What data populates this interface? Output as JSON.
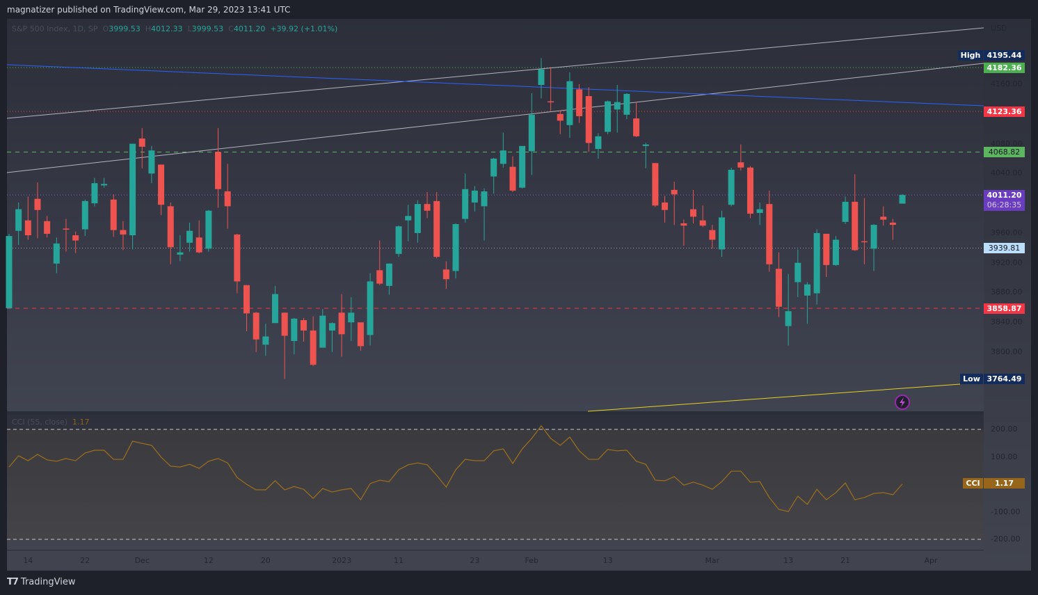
{
  "header": {
    "publisher": "magnatizer published on TradingView.com, Mar 29, 2023 13:41 UTC"
  },
  "legend": {
    "symbol": "S&P 500 Index, 1D, SP",
    "o_label": "O",
    "open": "3999.53",
    "h_label": "H",
    "high": "4012.33",
    "l_label": "L",
    "low": "3999.53",
    "c_label": "C",
    "close": "4011.20",
    "change": "+39.92 (+1.01%)"
  },
  "footer": {
    "brand": "TradingView"
  },
  "colors": {
    "up": "#26a69a",
    "down": "#ef5350",
    "cci": "#a0701a",
    "trend_blue": "#2962ff",
    "trend_white": "#b2b5be",
    "trend_yellow": "#e6d21f"
  },
  "badges": {
    "high_label": "High",
    "high_value": "4195.44",
    "level1": "4182.36",
    "level2": "4123.36",
    "level3": "4068.82",
    "last_price": "4011.20",
    "countdown": "06:28:35",
    "level4": "3939.81",
    "level5": "3858.87",
    "low_label": "Low",
    "low_value": "3764.49",
    "cci_label": "CCI",
    "cci_value": "1.17"
  },
  "chart_data": {
    "type": "candlestick",
    "currency": "USD",
    "price_ticks": [
      "4160.00",
      "4080.00",
      "4040.00",
      "3960.00",
      "3920.00",
      "3880.00",
      "3840.00",
      "3800.00"
    ],
    "levels": [
      4182.36,
      4123.36,
      4068.82,
      4011.2,
      3939.81,
      3858.87
    ],
    "x_ticks": [
      {
        "label": "14",
        "bar": 2
      },
      {
        "label": "22",
        "bar": 8
      },
      {
        "label": "Dec",
        "bar": 14
      },
      {
        "label": "12",
        "bar": 21
      },
      {
        "label": "20",
        "bar": 27
      },
      {
        "label": "2023",
        "bar": 35
      },
      {
        "label": "11",
        "bar": 41
      },
      {
        "label": "23",
        "bar": 49
      },
      {
        "label": "Feb",
        "bar": 55
      },
      {
        "label": "13",
        "bar": 63
      },
      {
        "label": "Mar",
        "bar": 74
      },
      {
        "label": "13",
        "bar": 82
      },
      {
        "label": "21",
        "bar": 88
      },
      {
        "label": "Apr",
        "bar": 97
      }
    ],
    "candles": [
      [
        "Nov 10",
        3859,
        3959,
        3859,
        3956
      ],
      [
        "Nov 11",
        3963,
        4001,
        3944,
        3992
      ],
      [
        "Nov 14",
        3977,
        4009,
        3951,
        3957
      ],
      [
        "Nov 15",
        4006,
        4028,
        3953,
        3991
      ],
      [
        "Nov 16",
        3976,
        3983,
        3954,
        3959
      ],
      [
        "Nov 17",
        3919,
        3954,
        3906,
        3946
      ],
      [
        "Nov 18",
        3966,
        3979,
        3935,
        3965
      ],
      [
        "Nov 21",
        3957,
        3962,
        3933,
        3950
      ],
      [
        "Nov 22",
        3965,
        4005,
        3956,
        4003
      ],
      [
        "Nov 23",
        4000,
        4034,
        3996,
        4027
      ],
      [
        "Nov 25",
        4024,
        4034,
        4021,
        4026
      ],
      [
        "Nov 28",
        4005,
        4012,
        3955,
        3964
      ],
      [
        "Nov 29",
        3964,
        3976,
        3937,
        3958
      ],
      [
        "Nov 30",
        3957,
        4080,
        3938,
        4080
      ],
      [
        "Dec 1",
        4087,
        4101,
        4047,
        4076
      ],
      [
        "Dec 2",
        4040,
        4077,
        4027,
        4071
      ],
      [
        "Dec 5",
        4052,
        4052,
        3984,
        3998
      ],
      [
        "Dec 6",
        3996,
        4001,
        3918,
        3941
      ],
      [
        "Dec 7",
        3931,
        3957,
        3922,
        3934
      ],
      [
        "Dec 8",
        3947,
        3974,
        3935,
        3963
      ],
      [
        "Dec 9",
        3954,
        3977,
        3933,
        3934
      ],
      [
        "Dec 12",
        3939,
        3991,
        3935,
        3990
      ],
      [
        "Dec 13",
        4069,
        4101,
        3994,
        4019
      ],
      [
        "Dec 14",
        4016,
        4053,
        3966,
        3996
      ],
      [
        "Dec 15",
        3958,
        3959,
        3879,
        3895
      ],
      [
        "Dec 16",
        3890,
        3890,
        3828,
        3852
      ],
      [
        "Dec 19",
        3853,
        3854,
        3800,
        3817
      ],
      [
        "Dec 20",
        3810,
        3838,
        3795,
        3821
      ],
      [
        "Dec 21",
        3839,
        3889,
        3839,
        3878
      ],
      [
        "Dec 22",
        3853,
        3853,
        3764,
        3822
      ],
      [
        "Dec 23",
        3815,
        3846,
        3797,
        3845
      ],
      [
        "Dec 27",
        3843,
        3846,
        3814,
        3829
      ],
      [
        "Dec 28",
        3829,
        3848,
        3781,
        3783
      ],
      [
        "Dec 29",
        3806,
        3858,
        3806,
        3849
      ],
      [
        "Dec 30",
        3829,
        3840,
        3800,
        3839
      ],
      [
        "Jan 3",
        3853,
        3878,
        3794,
        3824
      ],
      [
        "Jan 4",
        3840,
        3874,
        3815,
        3853
      ],
      [
        "Jan 5",
        3840,
        3840,
        3802,
        3808
      ],
      [
        "Jan 6",
        3823,
        3906,
        3809,
        3895
      ],
      [
        "Jan 9",
        3910,
        3950,
        3890,
        3892
      ],
      [
        "Jan 10",
        3889,
        3919,
        3877,
        3919
      ],
      [
        "Jan 11",
        3932,
        3970,
        3928,
        3969
      ],
      [
        "Jan 12",
        3977,
        3998,
        3949,
        3983
      ],
      [
        "Jan 13",
        3960,
        4004,
        3947,
        3999
      ],
      [
        "Jan 17",
        3999,
        4015,
        3980,
        3990
      ],
      [
        "Jan 18",
        4003,
        4015,
        3926,
        3928
      ],
      [
        "Jan 19",
        3911,
        3922,
        3885,
        3898
      ],
      [
        "Jan 20",
        3909,
        3973,
        3899,
        3972
      ],
      [
        "Jan 23",
        3979,
        4040,
        3974,
        4019
      ],
      [
        "Jan 24",
        4001,
        4023,
        3989,
        4017
      ],
      [
        "Jan 25",
        3996,
        4020,
        3950,
        4016
      ],
      [
        "Jan 26",
        4036,
        4061,
        4013,
        4060
      ],
      [
        "Jan 27",
        4053,
        4095,
        4048,
        4071
      ],
      [
        "Jan 30",
        4049,
        4063,
        4015,
        4017
      ],
      [
        "Jan 31",
        4021,
        4077,
        4020,
        4077
      ],
      [
        "Feb 1",
        4070,
        4148,
        4038,
        4119
      ],
      [
        "Feb 2",
        4159,
        4195,
        4141,
        4180
      ],
      [
        "Feb 3",
        4137,
        4183,
        4124,
        4136
      ],
      [
        "Feb 6",
        4120,
        4125,
        4093,
        4111
      ],
      [
        "Feb 7",
        4105,
        4176,
        4088,
        4164
      ],
      [
        "Feb 8",
        4153,
        4160,
        4108,
        4117
      ],
      [
        "Feb 9",
        4144,
        4156,
        4069,
        4081
      ],
      [
        "Feb 10",
        4073,
        4094,
        4060,
        4090
      ],
      [
        "Feb 13",
        4096,
        4138,
        4093,
        4137
      ],
      [
        "Feb 14",
        4126,
        4159,
        4095,
        4136
      ],
      [
        "Feb 15",
        4119,
        4148,
        4113,
        4147
      ],
      [
        "Feb 16",
        4114,
        4136,
        4089,
        4090
      ],
      [
        "Feb 17",
        4077,
        4081,
        4047,
        4079
      ],
      [
        "Feb 21",
        4054,
        4054,
        3995,
        3997
      ],
      [
        "Feb 22",
        4001,
        4010,
        3974,
        3991
      ],
      [
        "Feb 23",
        4018,
        4029,
        3971,
        4012
      ],
      [
        "Feb 24",
        3973,
        3978,
        3943,
        3970
      ],
      [
        "Feb 27",
        3992,
        4018,
        3973,
        3982
      ],
      [
        "Feb 28",
        3977,
        3997,
        3968,
        3970
      ],
      [
        "Mar 1",
        3964,
        3971,
        3939,
        3951
      ],
      [
        "Mar 2",
        3938,
        3990,
        3928,
        3981
      ],
      [
        "Mar 3",
        3998,
        4048,
        3996,
        4045
      ],
      [
        "Mar 6",
        4055,
        4079,
        4044,
        4048
      ],
      [
        "Mar 7",
        4048,
        4050,
        3980,
        3986
      ],
      [
        "Mar 8",
        3987,
        4001,
        3971,
        3992
      ],
      [
        "Mar 9",
        3999,
        4017,
        3908,
        3918
      ],
      [
        "Mar 10",
        3912,
        3934,
        3847,
        3861
      ],
      [
        "Mar 13",
        3835,
        3905,
        3809,
        3855
      ],
      [
        "Mar 14",
        3894,
        3938,
        3874,
        3920
      ],
      [
        "Mar 15",
        3876,
        3894,
        3838,
        3891
      ],
      [
        "Mar 16",
        3879,
        3965,
        3864,
        3960
      ],
      [
        "Mar 17",
        3959,
        3959,
        3901,
        3917
      ],
      [
        "Mar 20",
        3917,
        3956,
        3916,
        3951
      ],
      [
        "Mar 21",
        3975,
        4009,
        3972,
        4002
      ],
      [
        "Mar 22",
        4002,
        4039,
        3936,
        3937
      ],
      [
        "Mar 23",
        3949,
        4007,
        3918,
        3948
      ],
      [
        "Mar 24",
        3939,
        3972,
        3909,
        3971
      ],
      [
        "Mar 27",
        3982,
        3996,
        3970,
        3978
      ],
      [
        "Mar 28",
        3974,
        3979,
        3951,
        3971
      ],
      [
        "Mar 29",
        3999.53,
        4012.33,
        3999.53,
        4011.2
      ]
    ],
    "cci": {
      "title": "CCI (55, close)",
      "last": "1.17",
      "ticks": [
        "200.00",
        "100.00",
        "-100.00",
        "-200.00"
      ],
      "bands": [
        200,
        -200
      ],
      "values": [
        63,
        104,
        86,
        109,
        89,
        84,
        94,
        86,
        114,
        124,
        124,
        91,
        91,
        157,
        149,
        142,
        99,
        66,
        63,
        73,
        58,
        84,
        94,
        78,
        25,
        0,
        -20,
        -20,
        13,
        -20,
        -8,
        -18,
        -51,
        -15,
        -28,
        -20,
        -15,
        -56,
        3,
        15,
        10,
        53,
        71,
        78,
        71,
        33,
        -10,
        53,
        91,
        86,
        86,
        122,
        129,
        76,
        129,
        167,
        213,
        167,
        142,
        172,
        122,
        91,
        91,
        127,
        122,
        124,
        84,
        73,
        15,
        13,
        28,
        -3,
        8,
        -3,
        -18,
        10,
        48,
        48,
        8,
        10,
        -48,
        -91,
        -99,
        -43,
        -73,
        -18,
        -56,
        -30,
        5,
        -56,
        -48,
        -33,
        -30,
        -38,
        1.17
      ]
    }
  }
}
